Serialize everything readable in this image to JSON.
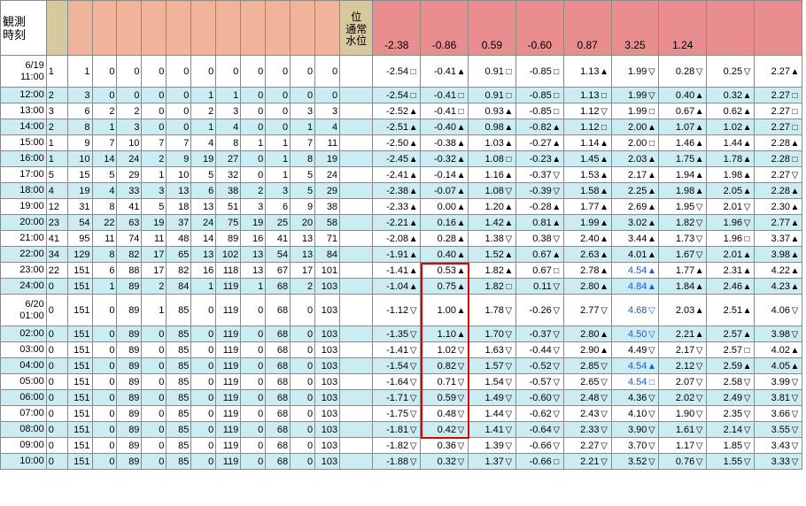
{
  "header": {
    "time_label": "観測\n時刻",
    "wl_top": "位",
    "wl_bottom": "通常\n水位",
    "levels": [
      "-2.38",
      "-0.86",
      "0.59",
      "-0.60",
      "0.87",
      "3.25",
      "1.24",
      "",
      ""
    ]
  },
  "rows": [
    {
      "time": "6/19\n11:00",
      "tall": true,
      "alt": false,
      "rain": [
        "1",
        "1",
        "0",
        "0",
        "0",
        "0",
        "0",
        "0",
        "0",
        "0",
        "0",
        "0"
      ],
      "levels": [
        [
          "-2.54",
          "□"
        ],
        [
          "-0.41",
          "▲"
        ],
        [
          "0.91",
          "□"
        ],
        [
          "-0.85",
          "□"
        ],
        [
          "1.13",
          "▲"
        ],
        [
          "1.99",
          "▽"
        ],
        [
          "0.28",
          "▽"
        ],
        [
          "0.25",
          "▽"
        ],
        [
          "2.27",
          "▲"
        ]
      ]
    },
    {
      "time": "12:00",
      "alt": true,
      "rain": [
        "2",
        "3",
        "0",
        "0",
        "0",
        "0",
        "1",
        "1",
        "0",
        "0",
        "0",
        "0"
      ],
      "levels": [
        [
          "-2.54",
          "□"
        ],
        [
          "-0.41",
          "□"
        ],
        [
          "0.91",
          "□"
        ],
        [
          "-0.85",
          "□"
        ],
        [
          "1.13",
          "□"
        ],
        [
          "1.99",
          "▽"
        ],
        [
          "0.40",
          "▲"
        ],
        [
          "0.32",
          "▲"
        ],
        [
          "2.27",
          "□"
        ]
      ]
    },
    {
      "time": "13:00",
      "alt": false,
      "rain": [
        "3",
        "6",
        "2",
        "2",
        "0",
        "0",
        "2",
        "3",
        "0",
        "0",
        "3",
        "3"
      ],
      "levels": [
        [
          "-2.52",
          "▲"
        ],
        [
          "-0.41",
          "□"
        ],
        [
          "0.93",
          "▲"
        ],
        [
          "-0.85",
          "□"
        ],
        [
          "1.12",
          "▽"
        ],
        [
          "1.99",
          "□"
        ],
        [
          "0.67",
          "▲"
        ],
        [
          "0.62",
          "▲"
        ],
        [
          "2.27",
          "□"
        ]
      ]
    },
    {
      "time": "14:00",
      "alt": true,
      "rain": [
        "2",
        "8",
        "1",
        "3",
        "0",
        "0",
        "1",
        "4",
        "0",
        "0",
        "1",
        "4"
      ],
      "levels": [
        [
          "-2.51",
          "▲"
        ],
        [
          "-0.40",
          "▲"
        ],
        [
          "0.98",
          "▲"
        ],
        [
          "-0.82",
          "▲"
        ],
        [
          "1.12",
          "□"
        ],
        [
          "2.00",
          "▲"
        ],
        [
          "1.07",
          "▲"
        ],
        [
          "1.02",
          "▲"
        ],
        [
          "2.27",
          "□"
        ]
      ]
    },
    {
      "time": "15:00",
      "alt": false,
      "rain": [
        "1",
        "9",
        "7",
        "10",
        "7",
        "7",
        "4",
        "8",
        "1",
        "1",
        "7",
        "11"
      ],
      "levels": [
        [
          "-2.50",
          "▲"
        ],
        [
          "-0.38",
          "▲"
        ],
        [
          "1.03",
          "▲"
        ],
        [
          "-0.27",
          "▲"
        ],
        [
          "1.14",
          "▲"
        ],
        [
          "2.00",
          "□"
        ],
        [
          "1.46",
          "▲"
        ],
        [
          "1.44",
          "▲"
        ],
        [
          "2.28",
          "▲"
        ]
      ]
    },
    {
      "time": "16:00",
      "alt": true,
      "rain": [
        "1",
        "10",
        "14",
        "24",
        "2",
        "9",
        "19",
        "27",
        "0",
        "1",
        "8",
        "19"
      ],
      "levels": [
        [
          "-2.45",
          "▲"
        ],
        [
          "-0.32",
          "▲"
        ],
        [
          "1.08",
          "□"
        ],
        [
          "-0.23",
          "▲"
        ],
        [
          "1.45",
          "▲"
        ],
        [
          "2.03",
          "▲"
        ],
        [
          "1.75",
          "▲"
        ],
        [
          "1.78",
          "▲"
        ],
        [
          "2.28",
          "□"
        ]
      ]
    },
    {
      "time": "17:00",
      "alt": false,
      "rain": [
        "5",
        "15",
        "5",
        "29",
        "1",
        "10",
        "5",
        "32",
        "0",
        "1",
        "5",
        "24"
      ],
      "levels": [
        [
          "-2.41",
          "▲"
        ],
        [
          "-0.14",
          "▲"
        ],
        [
          "1.16",
          "▲"
        ],
        [
          "-0.37",
          "▽"
        ],
        [
          "1.53",
          "▲"
        ],
        [
          "2.17",
          "▲"
        ],
        [
          "1.94",
          "▲"
        ],
        [
          "1.98",
          "▲"
        ],
        [
          "2.27",
          "▽"
        ]
      ]
    },
    {
      "time": "18:00",
      "alt": true,
      "rain": [
        "4",
        "19",
        "4",
        "33",
        "3",
        "13",
        "6",
        "38",
        "2",
        "3",
        "5",
        "29"
      ],
      "levels": [
        [
          "-2.38",
          "▲"
        ],
        [
          "-0.07",
          "▲"
        ],
        [
          "1.08",
          "▽"
        ],
        [
          "-0.39",
          "▽"
        ],
        [
          "1.58",
          "▲"
        ],
        [
          "2.25",
          "▲"
        ],
        [
          "1.98",
          "▲"
        ],
        [
          "2.05",
          "▲"
        ],
        [
          "2.28",
          "▲"
        ]
      ]
    },
    {
      "time": "19:00",
      "alt": false,
      "rain": [
        "12",
        "31",
        "8",
        "41",
        "5",
        "18",
        "13",
        "51",
        "3",
        "6",
        "9",
        "38"
      ],
      "levels": [
        [
          "-2.33",
          "▲"
        ],
        [
          "0.00",
          "▲"
        ],
        [
          "1.20",
          "▲"
        ],
        [
          "-0.28",
          "▲"
        ],
        [
          "1.77",
          "▲"
        ],
        [
          "2.69",
          "▲"
        ],
        [
          "1.95",
          "▽"
        ],
        [
          "2.01",
          "▽"
        ],
        [
          "2.30",
          "▲"
        ]
      ]
    },
    {
      "time": "20:00",
      "alt": true,
      "rain": [
        "23",
        "54",
        "22",
        "63",
        "19",
        "37",
        "24",
        "75",
        "19",
        "25",
        "20",
        "58"
      ],
      "levels": [
        [
          "-2.21",
          "▲"
        ],
        [
          "0.16",
          "▲"
        ],
        [
          "1.42",
          "▲"
        ],
        [
          "0.81",
          "▲"
        ],
        [
          "1.99",
          "▲"
        ],
        [
          "3.02",
          "▲"
        ],
        [
          "1.82",
          "▽"
        ],
        [
          "1.96",
          "▽"
        ],
        [
          "2.77",
          "▲"
        ]
      ]
    },
    {
      "time": "21:00",
      "alt": false,
      "rain": [
        "41",
        "95",
        "11",
        "74",
        "11",
        "48",
        "14",
        "89",
        "16",
        "41",
        "13",
        "71"
      ],
      "levels": [
        [
          "-2.08",
          "▲"
        ],
        [
          "0.28",
          "▲"
        ],
        [
          "1.38",
          "▽"
        ],
        [
          "0.38",
          "▽"
        ],
        [
          "2.40",
          "▲"
        ],
        [
          "3.44",
          "▲"
        ],
        [
          "1.73",
          "▽"
        ],
        [
          "1.96",
          "□"
        ],
        [
          "3.37",
          "▲"
        ]
      ]
    },
    {
      "time": "22:00",
      "alt": true,
      "rain": [
        "34",
        "129",
        "8",
        "82",
        "17",
        "65",
        "13",
        "102",
        "13",
        "54",
        "13",
        "84"
      ],
      "levels": [
        [
          "-1.91",
          "▲"
        ],
        [
          "0.40",
          "▲"
        ],
        [
          "1.52",
          "▲"
        ],
        [
          "0.67",
          "▲"
        ],
        [
          "2.63",
          "▲"
        ],
        [
          "4.01",
          "▲"
        ],
        [
          "1.67",
          "▽"
        ],
        [
          "2.01",
          "▲"
        ],
        [
          "3.98",
          "▲"
        ]
      ]
    },
    {
      "time": "23:00",
      "alt": false,
      "rain": [
        "22",
        "151",
        "6",
        "88",
        "17",
        "82",
        "16",
        "118",
        "13",
        "67",
        "17",
        "101"
      ],
      "levels": [
        [
          "-1.41",
          "▲"
        ],
        [
          "0.53",
          "▲"
        ],
        [
          "1.82",
          "▲"
        ],
        [
          "0.67",
          "□"
        ],
        [
          "2.78",
          "▲"
        ],
        [
          "4.54",
          "▲",
          "blue"
        ],
        [
          "1.77",
          "▲"
        ],
        [
          "2.31",
          "▲"
        ],
        [
          "4.22",
          "▲"
        ]
      ]
    },
    {
      "time": "24:00",
      "alt": true,
      "rain": [
        "0",
        "151",
        "1",
        "89",
        "2",
        "84",
        "1",
        "119",
        "1",
        "68",
        "2",
        "103"
      ],
      "levels": [
        [
          "-1.04",
          "▲"
        ],
        [
          "0.75",
          "▲"
        ],
        [
          "1.82",
          "□"
        ],
        [
          "0.11",
          "▽"
        ],
        [
          "2.80",
          "▲"
        ],
        [
          "4.84",
          "▲",
          "blue"
        ],
        [
          "1.84",
          "▲"
        ],
        [
          "2.46",
          "▲"
        ],
        [
          "4.23",
          "▲"
        ]
      ]
    },
    {
      "time": "6/20\n01:00",
      "tall": true,
      "alt": false,
      "rain": [
        "0",
        "151",
        "0",
        "89",
        "1",
        "85",
        "0",
        "119",
        "0",
        "68",
        "0",
        "103"
      ],
      "levels": [
        [
          "-1.12",
          "▽"
        ],
        [
          "1.00",
          "▲"
        ],
        [
          "1.78",
          "▽"
        ],
        [
          "-0.26",
          "▽"
        ],
        [
          "2.77",
          "▽"
        ],
        [
          "4.68",
          "▽",
          "blue"
        ],
        [
          "2.03",
          "▲"
        ],
        [
          "2.51",
          "▲"
        ],
        [
          "4.06",
          "▽"
        ]
      ]
    },
    {
      "time": "02:00",
      "alt": true,
      "rain": [
        "0",
        "151",
        "0",
        "89",
        "0",
        "85",
        "0",
        "119",
        "0",
        "68",
        "0",
        "103"
      ],
      "levels": [
        [
          "-1.35",
          "▽"
        ],
        [
          "1.10",
          "▲"
        ],
        [
          "1.70",
          "▽"
        ],
        [
          "-0.37",
          "▽"
        ],
        [
          "2.80",
          "▲"
        ],
        [
          "4.50",
          "▽",
          "blue"
        ],
        [
          "2.21",
          "▲"
        ],
        [
          "2.57",
          "▲"
        ],
        [
          "3.98",
          "▽"
        ]
      ]
    },
    {
      "time": "03:00",
      "alt": false,
      "rain": [
        "0",
        "151",
        "0",
        "89",
        "0",
        "85",
        "0",
        "119",
        "0",
        "68",
        "0",
        "103"
      ],
      "levels": [
        [
          "-1.41",
          "▽"
        ],
        [
          "1.02",
          "▽"
        ],
        [
          "1.63",
          "▽"
        ],
        [
          "-0.44",
          "▽"
        ],
        [
          "2.90",
          "▲"
        ],
        [
          "4.49",
          "▽"
        ],
        [
          "2.17",
          "▽"
        ],
        [
          "2.57",
          "□"
        ],
        [
          "4.02",
          "▲"
        ]
      ]
    },
    {
      "time": "04:00",
      "alt": true,
      "rain": [
        "0",
        "151",
        "0",
        "89",
        "0",
        "85",
        "0",
        "119",
        "0",
        "68",
        "0",
        "103"
      ],
      "levels": [
        [
          "-1.54",
          "▽"
        ],
        [
          "0.82",
          "▽"
        ],
        [
          "1.57",
          "▽"
        ],
        [
          "-0.52",
          "▽"
        ],
        [
          "2.85",
          "▽"
        ],
        [
          "4.54",
          "▲",
          "blue"
        ],
        [
          "2.12",
          "▽"
        ],
        [
          "2.59",
          "▲"
        ],
        [
          "4.05",
          "▲"
        ]
      ]
    },
    {
      "time": "05:00",
      "alt": false,
      "rain": [
        "0",
        "151",
        "0",
        "89",
        "0",
        "85",
        "0",
        "119",
        "0",
        "68",
        "0",
        "103"
      ],
      "levels": [
        [
          "-1.64",
          "▽"
        ],
        [
          "0.71",
          "▽"
        ],
        [
          "1.54",
          "▽"
        ],
        [
          "-0.57",
          "▽"
        ],
        [
          "2.65",
          "▽"
        ],
        [
          "4.54",
          "□",
          "blue"
        ],
        [
          "2.07",
          "▽"
        ],
        [
          "2.58",
          "▽"
        ],
        [
          "3.99",
          "▽"
        ]
      ]
    },
    {
      "time": "06:00",
      "alt": true,
      "rain": [
        "0",
        "151",
        "0",
        "89",
        "0",
        "85",
        "0",
        "119",
        "0",
        "68",
        "0",
        "103"
      ],
      "levels": [
        [
          "-1.71",
          "▽"
        ],
        [
          "0.59",
          "▽"
        ],
        [
          "1.49",
          "▽"
        ],
        [
          "-0.60",
          "▽"
        ],
        [
          "2.48",
          "▽"
        ],
        [
          "4.36",
          "▽"
        ],
        [
          "2.02",
          "▽"
        ],
        [
          "2.49",
          "▽"
        ],
        [
          "3.81",
          "▽"
        ]
      ]
    },
    {
      "time": "07:00",
      "alt": false,
      "rain": [
        "0",
        "151",
        "0",
        "89",
        "0",
        "85",
        "0",
        "119",
        "0",
        "68",
        "0",
        "103"
      ],
      "levels": [
        [
          "-1.75",
          "▽"
        ],
        [
          "0.48",
          "▽"
        ],
        [
          "1.44",
          "▽"
        ],
        [
          "-0.62",
          "▽"
        ],
        [
          "2.43",
          "▽"
        ],
        [
          "4.10",
          "▽"
        ],
        [
          "1.90",
          "▽"
        ],
        [
          "2.35",
          "▽"
        ],
        [
          "3.66",
          "▽"
        ]
      ]
    },
    {
      "time": "08:00",
      "alt": true,
      "rain": [
        "0",
        "151",
        "0",
        "89",
        "0",
        "85",
        "0",
        "119",
        "0",
        "68",
        "0",
        "103"
      ],
      "levels": [
        [
          "-1.81",
          "▽"
        ],
        [
          "0.42",
          "▽"
        ],
        [
          "1.41",
          "▽"
        ],
        [
          "-0.64",
          "▽"
        ],
        [
          "2.33",
          "▽"
        ],
        [
          "3.90",
          "▽"
        ],
        [
          "1.61",
          "▽"
        ],
        [
          "2.14",
          "▽"
        ],
        [
          "3.55",
          "▽"
        ]
      ]
    },
    {
      "time": "09:00",
      "alt": false,
      "rain": [
        "0",
        "151",
        "0",
        "89",
        "0",
        "85",
        "0",
        "119",
        "0",
        "68",
        "0",
        "103"
      ],
      "levels": [
        [
          "-1.82",
          "▽"
        ],
        [
          "0.36",
          "▽"
        ],
        [
          "1.39",
          "▽"
        ],
        [
          "-0.66",
          "▽"
        ],
        [
          "2.27",
          "▽"
        ],
        [
          "3.70",
          "▽"
        ],
        [
          "1.17",
          "▽"
        ],
        [
          "1.85",
          "▽"
        ],
        [
          "3.43",
          "▽"
        ]
      ]
    },
    {
      "time": "10:00",
      "alt": true,
      "rain": [
        "0",
        "151",
        "0",
        "89",
        "0",
        "85",
        "0",
        "119",
        "0",
        "68",
        "0",
        "103"
      ],
      "levels": [
        [
          "-1.88",
          "▽"
        ],
        [
          "0.32",
          "▽"
        ],
        [
          "1.37",
          "▽"
        ],
        [
          "-0.66",
          "□"
        ],
        [
          "2.21",
          "▽"
        ],
        [
          "3.52",
          "▽"
        ],
        [
          "0.76",
          "▽"
        ],
        [
          "1.55",
          "▽"
        ],
        [
          "3.33",
          "▽"
        ]
      ]
    }
  ]
}
